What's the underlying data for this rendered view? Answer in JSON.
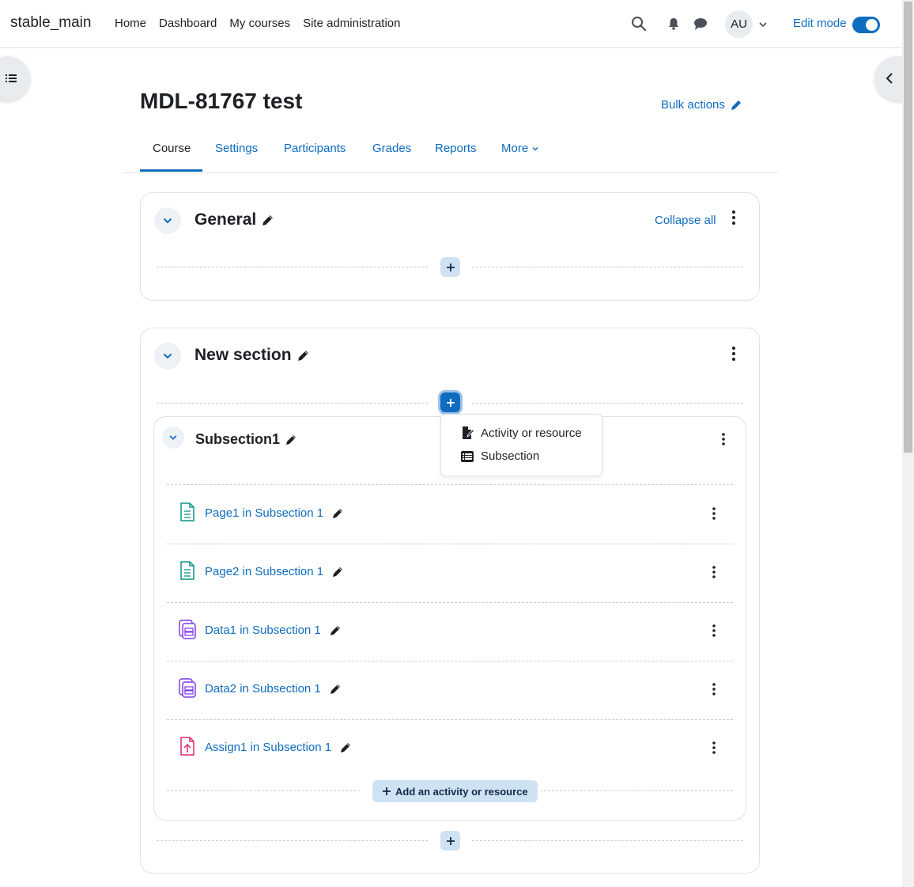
{
  "navbar": {
    "brand": "stable_main",
    "links": [
      "Home",
      "Dashboard",
      "My courses",
      "Site administration"
    ],
    "user_initials": "AU",
    "edit_mode_label": "Edit mode",
    "edit_mode_on": true
  },
  "course": {
    "title": "MDL-81767 test",
    "bulk_actions": "Bulk actions"
  },
  "tabs": [
    {
      "label": "Course",
      "active": true
    },
    {
      "label": "Settings"
    },
    {
      "label": "Participants"
    },
    {
      "label": "Grades"
    },
    {
      "label": "Reports"
    },
    {
      "label": "More"
    }
  ],
  "sections": {
    "general": {
      "title": "General",
      "collapse_all": "Collapse all"
    },
    "new_section": {
      "title": "New section"
    }
  },
  "subsection": {
    "title": "Subsection1",
    "activities": [
      {
        "name": "Page1 in Subsection 1",
        "icon": "page-icon"
      },
      {
        "name": "Page2 in Subsection 1",
        "icon": "page-icon"
      },
      {
        "name": "Data1 in Subsection 1",
        "icon": "database-icon"
      },
      {
        "name": "Data2 in Subsection 1",
        "icon": "database-icon"
      },
      {
        "name": "Assign1 in Subsection 1",
        "icon": "assignment-icon"
      }
    ],
    "add_button": "Add an activity or resource"
  },
  "dropdown": {
    "items": [
      "Activity or resource",
      "Subsection"
    ]
  },
  "colors": {
    "link": "#0f6cbf",
    "page_icon": "#0d9488",
    "database_icon": "#7c3aed",
    "assignment_icon": "#db2777"
  }
}
